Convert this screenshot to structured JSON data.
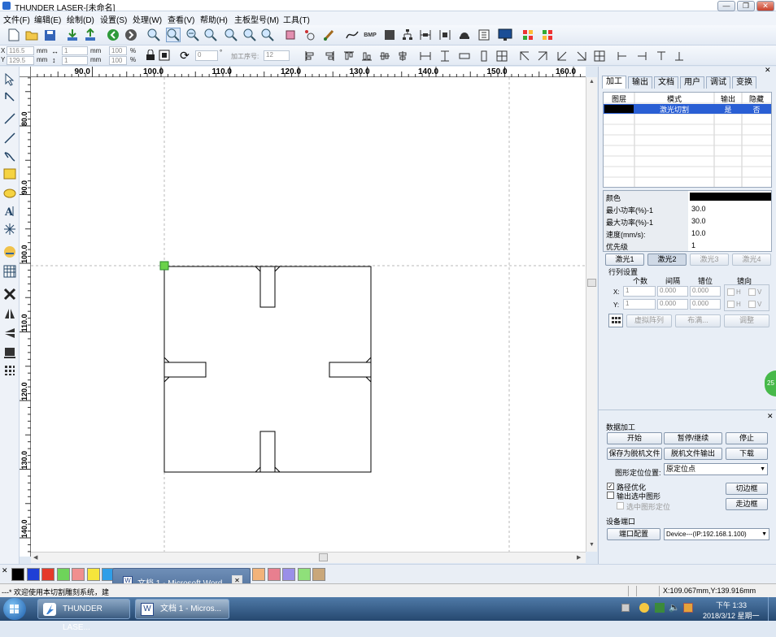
{
  "window": {
    "title": "THUNDER LASER-[未命名]",
    "controls": [
      "—",
      "❐",
      "✕"
    ]
  },
  "menu": [
    "文件(F)",
    "编辑(E)",
    "绘制(D)",
    "设置(S)",
    "处理(W)",
    "查看(V)",
    "帮助(H)",
    "主板型号(M)",
    "工具(T)"
  ],
  "toolbar2": {
    "x_label": "X",
    "y_label": "Y",
    "x_value": "116.5",
    "y_value": "129.5",
    "unit": "mm",
    "w_value": "1",
    "h_value": "1",
    "pct_w": "100",
    "pct_h": "100",
    "pct_sign": "%",
    "rotate_value": "0",
    "degree_sign": "°",
    "seq_label": "加工序号:",
    "seq_value": "12"
  },
  "rulers": {
    "h_ticks": [
      "90.0",
      "100.0",
      "110.0",
      "120.0",
      "130.0",
      "140.0",
      "150.0",
      "160.0"
    ],
    "v_ticks": [
      "80.0",
      "90.0",
      "100.0",
      "110.0",
      "120.0",
      "130.0",
      "140.0"
    ]
  },
  "panel": {
    "tabs": [
      "加工",
      "输出",
      "文档",
      "用户",
      "调试",
      "变换"
    ],
    "layer_headers": [
      "图层",
      "模式",
      "输出",
      "隐藏"
    ],
    "layer_row": {
      "mode": "激光切割",
      "output": "是",
      "hidden": "否",
      "color": "#000000"
    },
    "props": [
      {
        "label": "颜色",
        "value": ""
      },
      {
        "label": "最小功率(%)-1",
        "value": "30.0"
      },
      {
        "label": "最大功率(%)-1",
        "value": "30.0"
      },
      {
        "label": "速度(mm/s):",
        "value": "10.0"
      },
      {
        "label": "优先级",
        "value": "1"
      }
    ],
    "laser_buttons": [
      "激光1",
      "激光2",
      "激光3",
      "激光4"
    ],
    "array": {
      "title": "行列设置",
      "headers": [
        "个数",
        "间隔",
        "错位",
        "镜向"
      ],
      "x_label": "X:",
      "y_label": "Y:",
      "x_count": "1",
      "x_gap": "0.000",
      "x_offset": "0.000",
      "y_count": "1",
      "y_gap": "0.000",
      "y_offset": "0.000",
      "h": "H",
      "v": "V",
      "virtual_btn": "虚拟阵列",
      "layout_btn": "布满...",
      "adjust_btn": "调整"
    },
    "data": {
      "title": "数据加工",
      "start": "开始",
      "pause": "暂停/继续",
      "stop": "停止",
      "save_offline": "保存为脱机文件",
      "offline_out": "脱机文件输出",
      "download": "下载",
      "pos_label": "图形定位位置:",
      "pos_value": "原定位点",
      "path_opt": "路径优化",
      "out_selected": "输出选中图形",
      "sel_locate": "选中图形定位",
      "cut_frame": "切边框",
      "walk_frame": "走边框",
      "device_title": "设备端口",
      "port_config": "端口配置",
      "device_value": "Device---(IP:192.168.1.100)"
    }
  },
  "palette": [
    "#000000",
    "#1f3fd6",
    "#e53a2a",
    "#6ed45a",
    "#f08f8f",
    "#f6e53b",
    "#2e9ee8",
    "#ffffff",
    "#ffffff",
    "#ffffff",
    "#ffffff",
    "#ffffff",
    "#ffffff",
    "#ffffff",
    "#ffffff",
    "#ffffff",
    "#f2b37a",
    "#e87f8f",
    "#9a8fe8",
    "#8fe07a",
    "#c9a77a"
  ],
  "word_popup": {
    "label": "文档 1 - Microsoft Word",
    "close": "✕"
  },
  "status": {
    "left": "---* 欢迎使用本切割雕刻系统，建",
    "coords": "X:109.067mm,Y:139.916mm"
  },
  "taskbar": {
    "items": [
      "THUNDER LASE...",
      "文档 1 - Micros..."
    ],
    "time": "下午 1:33",
    "date": "2018/3/12 星期一"
  },
  "float_badge": "25"
}
